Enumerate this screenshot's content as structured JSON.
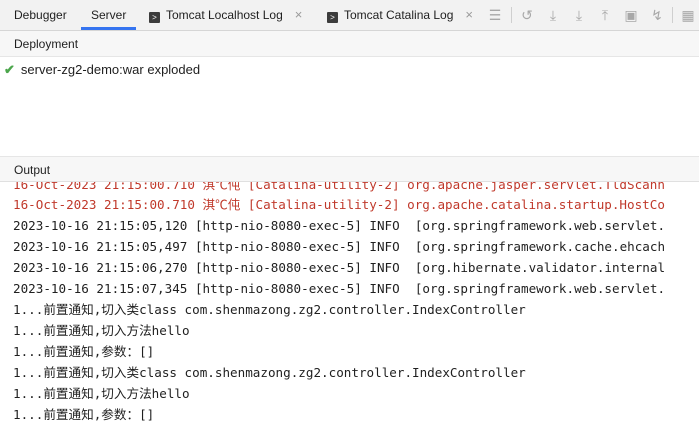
{
  "tabs": [
    {
      "label": "Debugger",
      "active": false,
      "icon": "",
      "closable": false
    },
    {
      "label": "Server",
      "active": true,
      "icon": "",
      "closable": false
    },
    {
      "label": "Tomcat Localhost Log",
      "active": false,
      "icon": "terminal-icon",
      "closable": true
    },
    {
      "label": "Tomcat Catalina Log",
      "active": false,
      "icon": "terminal-icon",
      "closable": true
    }
  ],
  "close_glyph": "×",
  "deployment": {
    "header": "Deployment",
    "item": "server-zg2-demo:war exploded",
    "status_icon": "check-icon"
  },
  "output": {
    "header": "Output",
    "lines": [
      {
        "text": "16-Oct-2023 21:15:00.710 淇℃伅 [Catalina-utility-2] org.apache.jasper.servlet.TldScann",
        "level": "error"
      },
      {
        "text": "16-Oct-2023 21:15:00.710 淇℃伅 [Catalina-utility-2] org.apache.catalina.startup.HostCo",
        "level": "error"
      },
      {
        "text": "2023-10-16 21:15:05,120 [http-nio-8080-exec-5] INFO  [org.springframework.web.servlet.",
        "level": "info"
      },
      {
        "text": "2023-10-16 21:15:05,497 [http-nio-8080-exec-5] INFO  [org.springframework.cache.ehcach",
        "level": "info"
      },
      {
        "text": "2023-10-16 21:15:06,270 [http-nio-8080-exec-5] INFO  [org.hibernate.validator.internal",
        "level": "info"
      },
      {
        "text": "2023-10-16 21:15:07,345 [http-nio-8080-exec-5] INFO  [org.springframework.web.servlet.",
        "level": "info"
      },
      {
        "text": "1...前置通知,切入类class com.shenmazong.zg2.controller.IndexController",
        "level": "info"
      },
      {
        "text": "1...前置通知,切入方法hello",
        "level": "info"
      },
      {
        "text": "1...前置通知,参数：[]",
        "level": "info"
      },
      {
        "text": "1...前置通知,切入类class com.shenmazong.zg2.controller.IndexController",
        "level": "info"
      },
      {
        "text": "1...前置通知,切入方法hello",
        "level": "info"
      },
      {
        "text": "1...前置通知,参数：[]",
        "level": "info"
      }
    ]
  },
  "toolbar_icons": [
    "menu-icon",
    "restart-icon",
    "download-icon",
    "download-icon",
    "upload-icon",
    "layout-icon",
    "filter-icon",
    "grid-icon"
  ],
  "colors": {
    "accent": "#3574f0",
    "error_text": "#c0392b",
    "success": "#4ca64c"
  }
}
